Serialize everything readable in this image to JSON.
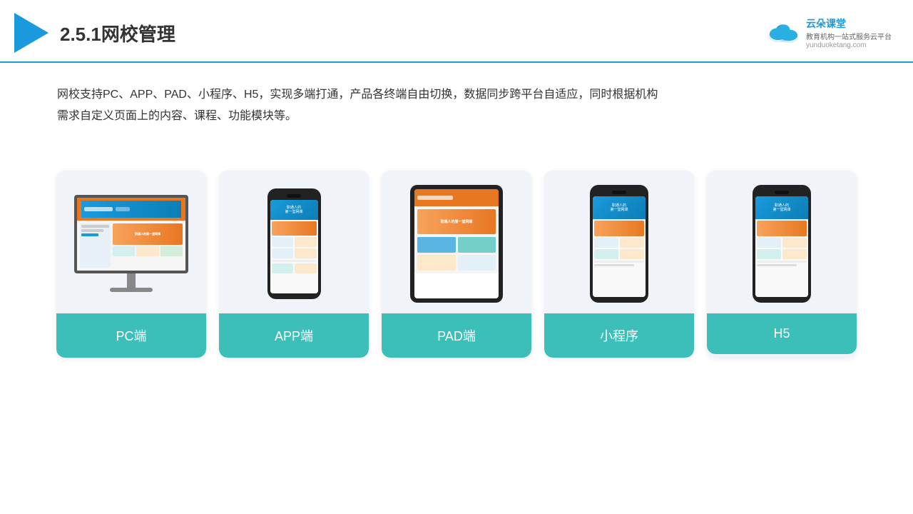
{
  "header": {
    "title": "2.5.1网校管理",
    "logo_brand": "云朵课堂",
    "logo_url": "yunduoketang.com",
    "logo_tagline_line1": "教育机构一站",
    "logo_tagline_line2": "式服务云平台"
  },
  "description": {
    "text_line1": "网校支持PC、APP、PAD、小程序、H5，实现多端打通，产品各终端自由切换，数据同步跨平台自适应，同时根据机构",
    "text_line2": "需求自定义页面上的内容、课程、功能模块等。"
  },
  "cards": [
    {
      "id": "pc",
      "label": "PC端"
    },
    {
      "id": "app",
      "label": "APP端"
    },
    {
      "id": "pad",
      "label": "PAD端"
    },
    {
      "id": "miniapp",
      "label": "小程序"
    },
    {
      "id": "h5",
      "label": "H5"
    }
  ],
  "colors": {
    "accent": "#1a9adc",
    "teal": "#3bbfb8",
    "border": "#1a9adc"
  }
}
